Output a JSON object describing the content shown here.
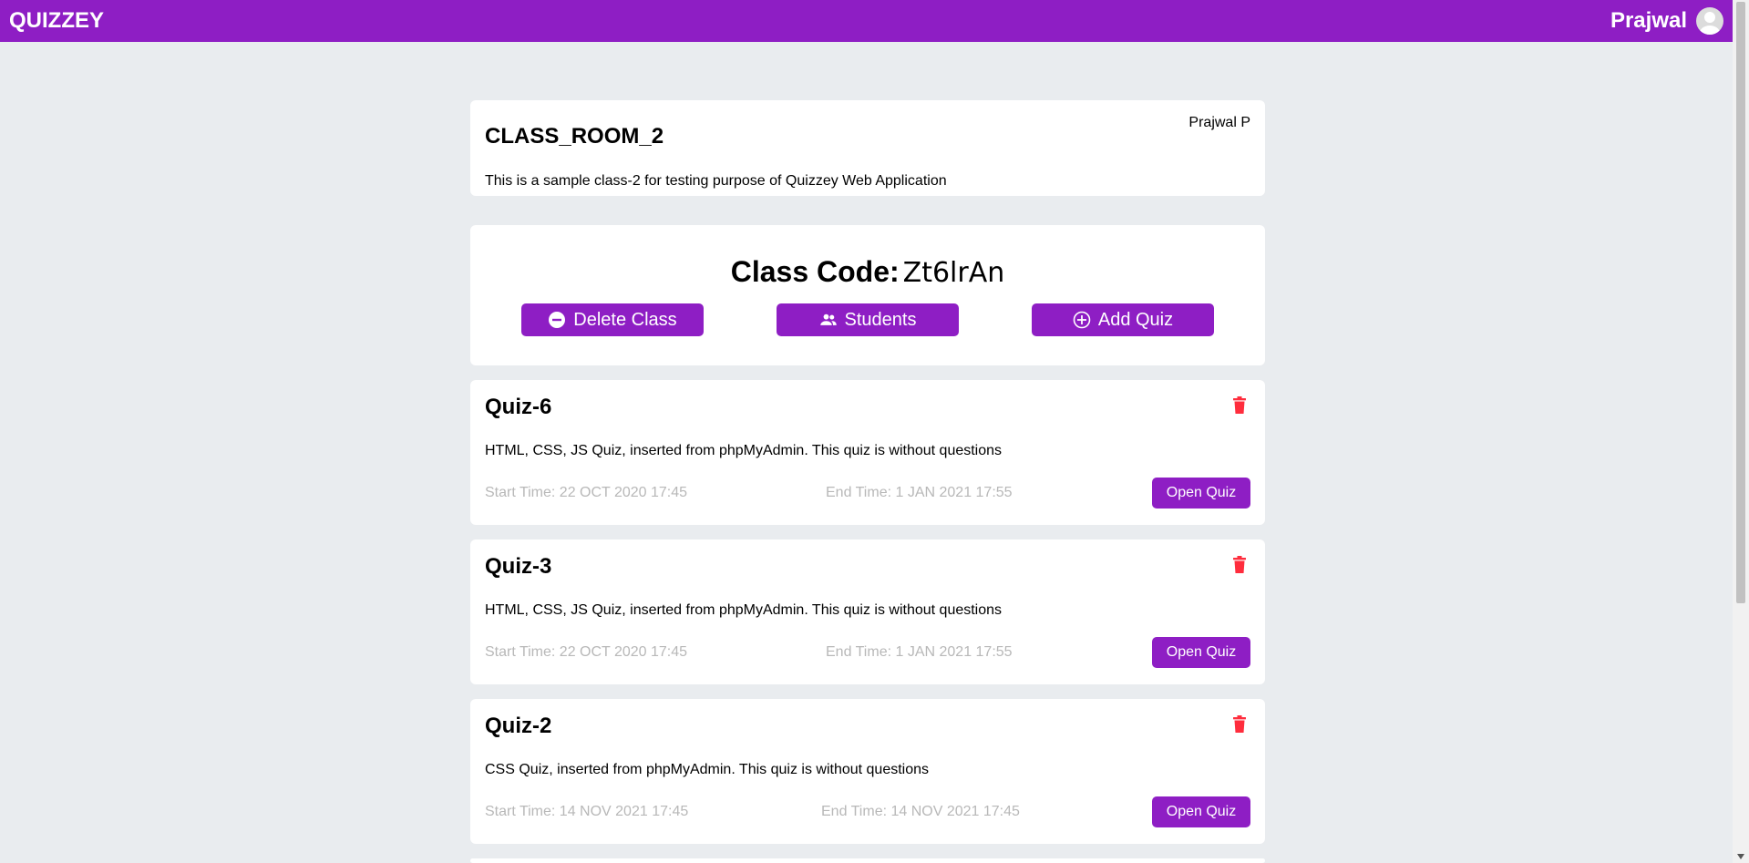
{
  "app": {
    "brand": "QUIZZEY",
    "user_name": "Prajwal"
  },
  "class": {
    "name": "CLASS_ROOM_2",
    "owner": "Prajwal P",
    "description": "This is a sample class-2 for testing purpose of Quizzey Web Application"
  },
  "code": {
    "label": "Class Code:",
    "value": "Zt6lrAn",
    "delete_label": "Delete Class",
    "students_label": "Students",
    "add_quiz_label": "Add Quiz"
  },
  "quizzes": [
    {
      "title": "Quiz-6",
      "description": "HTML, CSS, JS Quiz, inserted from phpMyAdmin. This quiz is without questions",
      "start": "Start Time: 22 OCT 2020 17:45",
      "end": "End Time: 1 JAN 2021 17:55",
      "open_label": "Open Quiz"
    },
    {
      "title": "Quiz-3",
      "description": "HTML, CSS, JS Quiz, inserted from phpMyAdmin. This quiz is without questions",
      "start": "Start Time: 22 OCT 2020 17:45",
      "end": "End Time: 1 JAN 2021 17:55",
      "open_label": "Open Quiz"
    },
    {
      "title": "Quiz-2",
      "description": "CSS Quiz, inserted from phpMyAdmin. This quiz is without questions",
      "start": "Start Time: 14 NOV 2021 17:45",
      "end": "End Time: 14 NOV 2021 17:45",
      "open_label": "Open Quiz"
    }
  ],
  "colors": {
    "accent": "#8e1ec4",
    "danger": "#ff2d3d",
    "muted": "#b8b8b8",
    "background": "#e9ecef"
  }
}
